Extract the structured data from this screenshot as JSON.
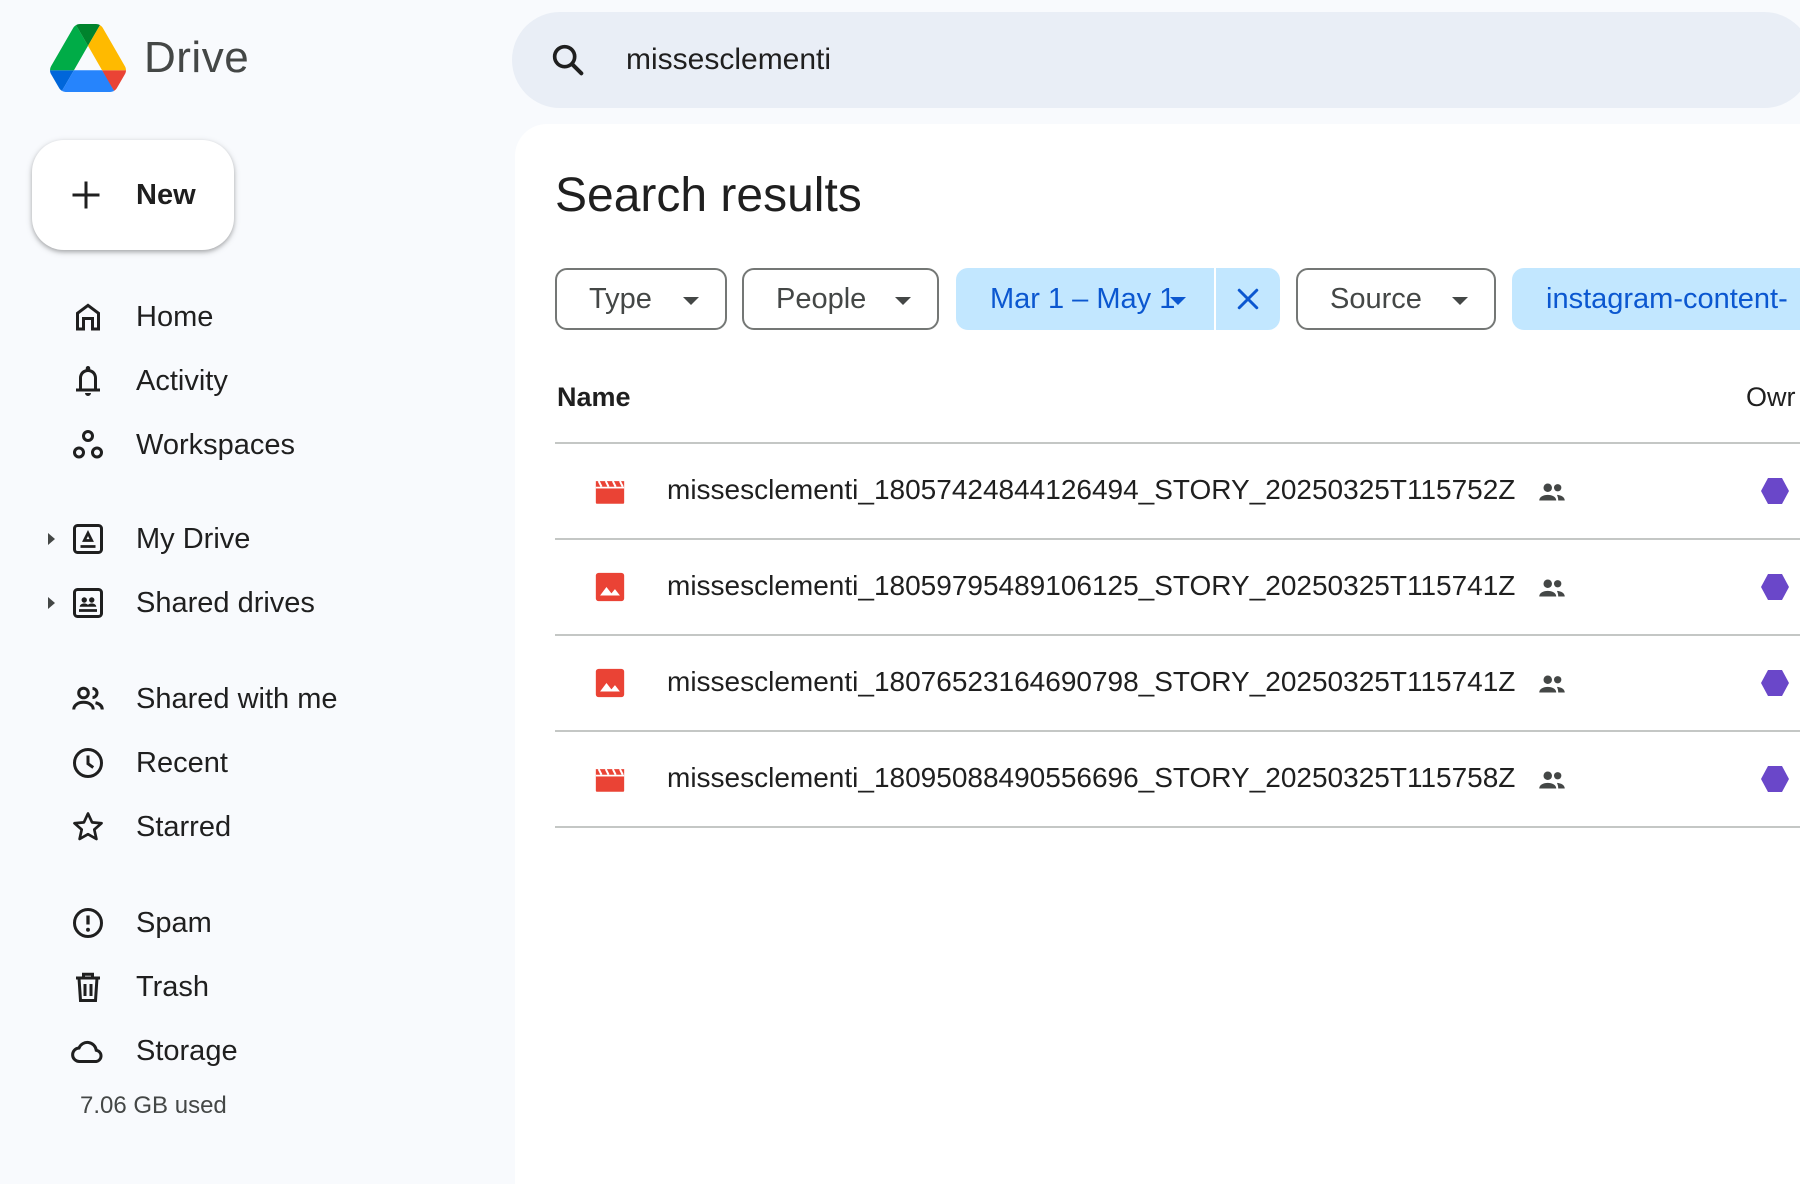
{
  "app": {
    "name": "Drive"
  },
  "sidebar": {
    "new_label": "New",
    "items": [
      {
        "label": "Home",
        "icon": "home-icon"
      },
      {
        "label": "Activity",
        "icon": "bell-icon"
      },
      {
        "label": "Workspaces",
        "icon": "workspaces-icon"
      },
      {
        "label": "My Drive",
        "icon": "my-drive-icon",
        "expandable": true
      },
      {
        "label": "Shared drives",
        "icon": "shared-drives-icon",
        "expandable": true
      },
      {
        "label": "Shared with me",
        "icon": "people-icon"
      },
      {
        "label": "Recent",
        "icon": "clock-icon"
      },
      {
        "label": "Starred",
        "icon": "star-icon"
      },
      {
        "label": "Spam",
        "icon": "spam-icon"
      },
      {
        "label": "Trash",
        "icon": "trash-icon"
      },
      {
        "label": "Storage",
        "icon": "cloud-icon"
      }
    ],
    "storage_used": "7.06 GB used"
  },
  "search": {
    "query": "missesclementi"
  },
  "main": {
    "title": "Search results",
    "filters": {
      "type": "Type",
      "people": "People",
      "date": "Mar 1 – May 1",
      "source": "Source",
      "location": "instagram-content-"
    },
    "columns": {
      "name": "Name",
      "owner": "Owr"
    },
    "files": [
      {
        "name": "missesclementi_18057424844126494_STORY_20250325T115752Z",
        "type": "video"
      },
      {
        "name": "missesclementi_18059795489106125_STORY_20250325T115741Z",
        "type": "image"
      },
      {
        "name": "missesclementi_18076523164690798_STORY_20250325T115741Z",
        "type": "image"
      },
      {
        "name": "missesclementi_18095088490556696_STORY_20250325T115758Z",
        "type": "video"
      }
    ]
  },
  "colors": {
    "accent": "#0b57d0",
    "chip_active_bg": "#c2e7ff",
    "file_icon_red": "#ea4335",
    "owner_avatar": "#6a47c9"
  }
}
